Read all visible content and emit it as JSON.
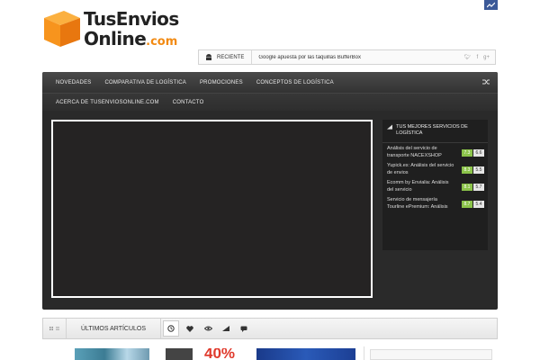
{
  "logo": {
    "line1": "TusEnvios",
    "line2": "Online",
    "suffix": ".com"
  },
  "ticker": {
    "label": "Reciente",
    "text": "Google apuesta por las taquillas BufferBox",
    "social_icons": [
      "twitter-icon",
      "facebook-icon",
      "google-plus-icon"
    ]
  },
  "nav": {
    "primary": [
      "Novedades",
      "Comparativa de logística",
      "Promociones",
      "Conceptos de logística"
    ],
    "secondary": [
      "Acerca de TusEnviosOnline.com",
      "Contacto"
    ]
  },
  "sidebar": {
    "title": "Tus mejores servicios de logística",
    "items": [
      {
        "title": "Análisis del servicio de transporte NACEXSHOP",
        "score_a": "7.3",
        "score_b": "6.6"
      },
      {
        "title": "Yupick.es: Análisis del servicio de envios",
        "score_a": "8.3",
        "score_b": "5.5"
      },
      {
        "title": "Ecomm by Envialia: Análisis del servicio",
        "score_a": "8.1",
        "score_b": "5.7"
      },
      {
        "title": "Servicio de mensajería Tourline ePremium: Análisis",
        "score_a": "8.7",
        "score_b": "5.4"
      }
    ]
  },
  "articles": {
    "title": "Últimos artículos",
    "tabs": [
      "clock-icon",
      "heart-icon",
      "eye-icon",
      "bar-chart-icon",
      "comment-icon"
    ],
    "thumb_text": "40%"
  },
  "colors": {
    "accent_orange": "#f28a12",
    "score_green": "#8bc34a",
    "corner_blue": "#3b5998"
  }
}
